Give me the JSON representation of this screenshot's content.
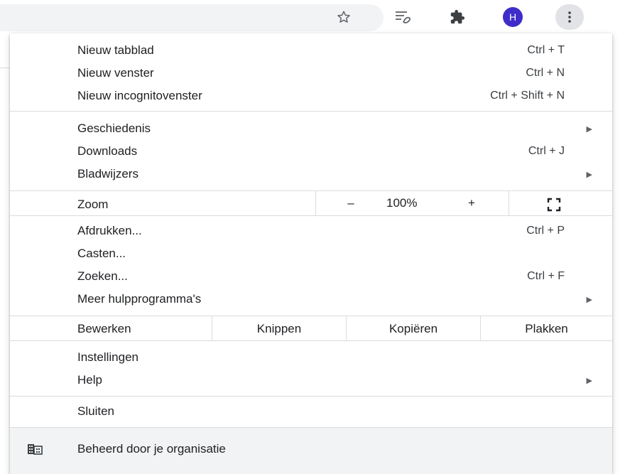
{
  "toolbar": {
    "profile_initial": "H",
    "icons": [
      "star-icon",
      "reading-list-icon",
      "extensions-icon",
      "kebab-menu-icon"
    ],
    "avatar_color": "#3f2dc9"
  },
  "menu": {
    "group1": [
      {
        "label": "Nieuw tabblad",
        "accel": "Ctrl + T"
      },
      {
        "label": "Nieuw venster",
        "accel": "Ctrl + N"
      },
      {
        "label": "Nieuw incognitovenster",
        "accel": "Ctrl + Shift + N"
      }
    ],
    "group2": [
      {
        "label": "Geschiedenis",
        "arrow": "▶"
      },
      {
        "label": "Downloads",
        "accel": "Ctrl + J"
      },
      {
        "label": "Bladwijzers",
        "arrow": "▶"
      }
    ],
    "zoom": {
      "label": "Zoom",
      "minus": "–",
      "value": "100%",
      "plus": "+"
    },
    "group3": [
      {
        "label": "Afdrukken...",
        "accel": "Ctrl + P"
      },
      {
        "label": "Casten..."
      },
      {
        "label": "Zoeken...",
        "accel": "Ctrl + F"
      },
      {
        "label": "Meer hulpprogramma's",
        "arrow": "▶"
      }
    ],
    "edit": {
      "label": "Bewerken",
      "cut": "Knippen",
      "copy": "Kopiëren",
      "paste": "Plakken"
    },
    "group4": [
      {
        "label": "Instellingen"
      },
      {
        "label": "Help",
        "arrow": "▶"
      }
    ],
    "exit": {
      "label": "Sluiten"
    },
    "managed": {
      "label": "Beheerd door je organisatie"
    }
  }
}
